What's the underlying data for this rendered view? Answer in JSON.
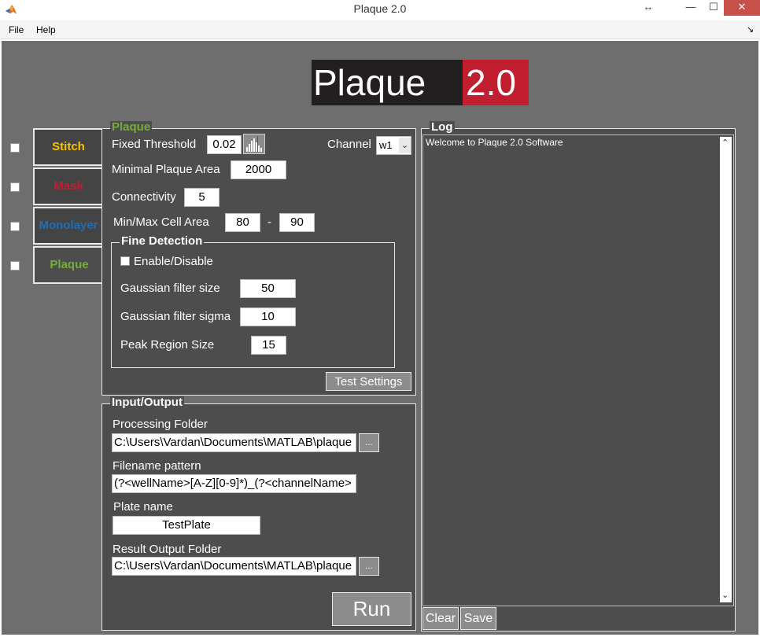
{
  "window": {
    "title": "Plaque 2.0",
    "resize_glyph": "↔",
    "min_glyph": "—",
    "max_glyph": "☐",
    "close_glyph": "✕"
  },
  "menu": {
    "file": "File",
    "help": "Help",
    "dock_glyph": "↘"
  },
  "logo": {
    "left_text": "Plaque ",
    "right_text": "2.0"
  },
  "side_tabs": [
    {
      "label": "Stitch",
      "color": "#f5c400",
      "checked": false
    },
    {
      "label": "Mask",
      "color": "#c11f2f",
      "checked": false
    },
    {
      "label": "Monolayer",
      "color": "#1e6fb5",
      "checked": false
    },
    {
      "label": "Plaque",
      "color": "#77ac3a",
      "checked": false
    }
  ],
  "plaque_panel": {
    "title": "Plaque",
    "title_color": "#77ac3a",
    "fixed_threshold_label": "Fixed Threshold",
    "fixed_threshold_value": "0.02",
    "histogram_icon": "histogram-icon",
    "channel_label": "Channel",
    "channel_value": "w1",
    "min_area_label": "Minimal Plaque Area",
    "min_area_value": "2000",
    "connectivity_label": "Connectivity",
    "connectivity_value": "5",
    "cell_area_label": "Min/Max Cell Area",
    "cell_area_min": "80",
    "cell_area_sep": "-",
    "cell_area_max": "90",
    "fine": {
      "title": "Fine Detection",
      "enable_label": "Enable/Disable",
      "enabled": false,
      "gauss_size_label": "Gaussian filter size",
      "gauss_size_value": "50",
      "gauss_sigma_label": "Gaussian filter sigma",
      "gauss_sigma_value": "10",
      "peak_label": "Peak Region Size",
      "peak_value": "15"
    },
    "test_button": "Test Settings"
  },
  "io_panel": {
    "title": "Input/Output",
    "processing_label": "Processing Folder",
    "processing_value": "C:\\Users\\Vardan\\Documents\\MATLAB\\plaque",
    "browse_label": "...",
    "pattern_label": "Filename pattern",
    "pattern_value": "(?<wellName>[A-Z][0-9]*)_(?<channelName>",
    "plate_label": "Plate name",
    "plate_value": "TestPlate",
    "output_label": "Result Output Folder",
    "output_value": "C:\\Users\\Vardan\\Documents\\MATLAB\\plaque",
    "run_button": "Run"
  },
  "log_panel": {
    "title": "Log",
    "text": "Welcome to Plaque 2.0 Software",
    "clear_button": "Clear",
    "save_button": "Save"
  }
}
